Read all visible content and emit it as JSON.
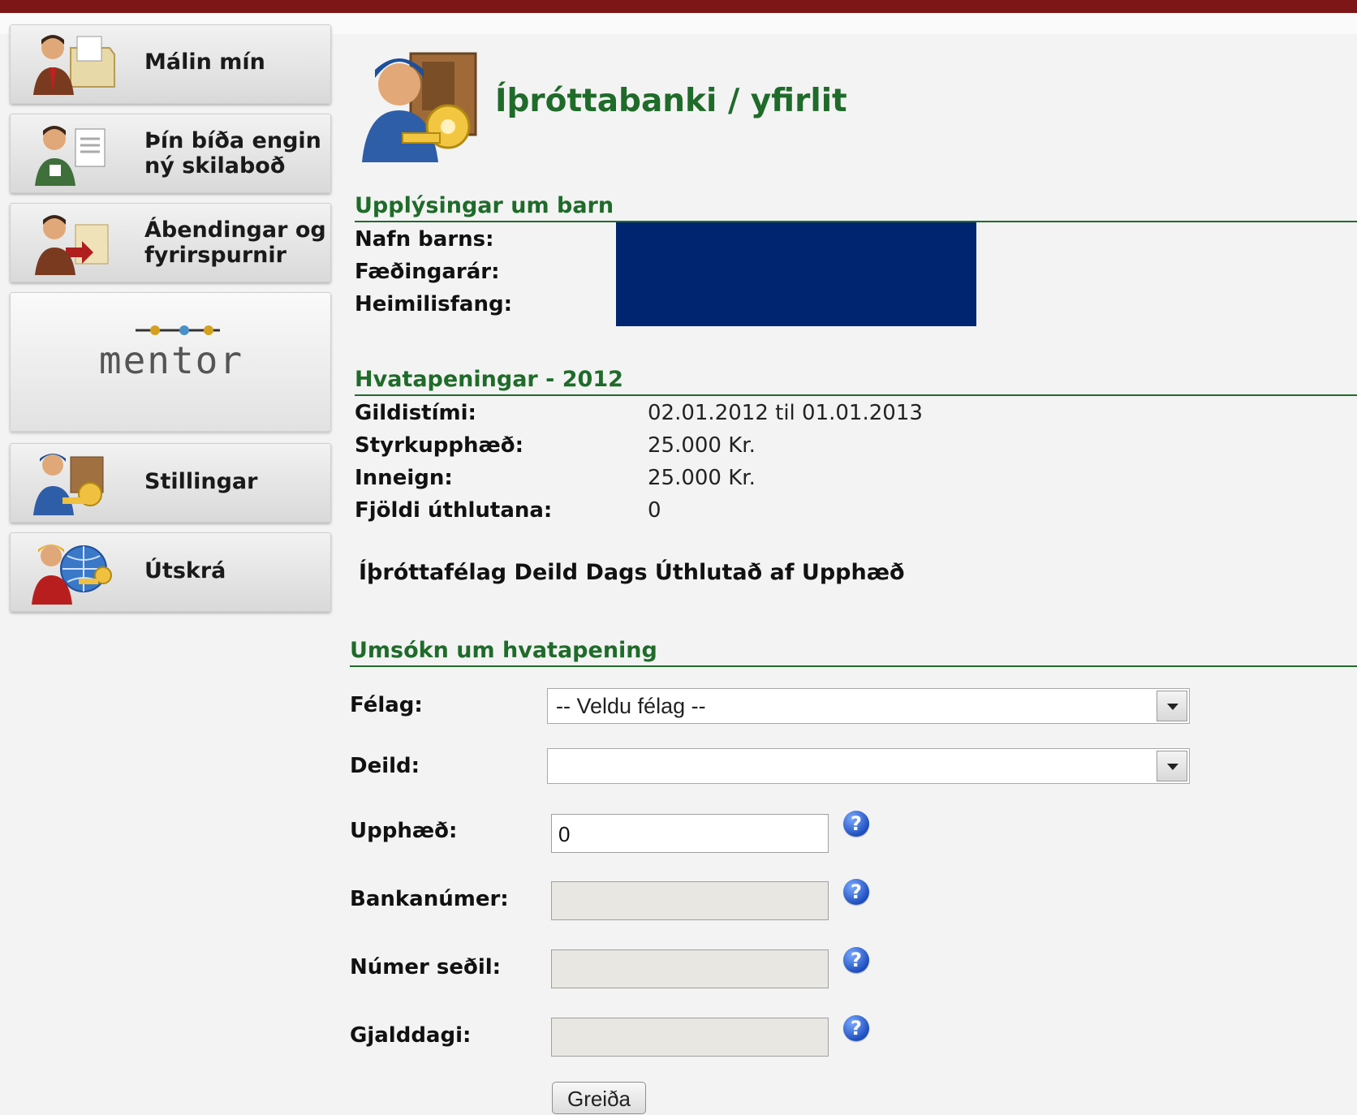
{
  "sidebar": {
    "items": [
      {
        "label": "Málin mín",
        "icon": "person-folder-icon"
      },
      {
        "label": "Þín bíða engin\nný skilaboð",
        "icon": "person-document-icon"
      },
      {
        "label": "Ábendingar og\nfyrirspurnir",
        "icon": "person-send-icon"
      },
      {
        "label": "Stillingar",
        "icon": "worker-key-icon"
      },
      {
        "label": "Útskrá",
        "icon": "person-globe-key-icon"
      }
    ],
    "logo_text": "mentor"
  },
  "page": {
    "title": "Íþróttabanki / yfirlit"
  },
  "child_info": {
    "heading": "Upplýsingar um barn",
    "labels": [
      "Nafn barns:",
      "Fæðingarár:",
      "Heimilisfang:"
    ]
  },
  "incentive": {
    "heading": "Hvatapeningar - 2012",
    "rows": [
      {
        "label": "Gildistími:",
        "value": "02.01.2012 til 01.01.2013"
      },
      {
        "label": "Styrkupphæð:",
        "value": "25.000 Kr."
      },
      {
        "label": "Inneign:",
        "value": "25.000 Kr."
      },
      {
        "label": "Fjöldi úthlutana:",
        "value": "0"
      }
    ],
    "table_header": "Íþróttafélag Deild Dags Úthlutað af Upphæð"
  },
  "application": {
    "heading": "Umsókn um hvatapening",
    "club_label": "Félag:",
    "club_selected": "-- Veldu félag --",
    "dept_label": "Deild:",
    "dept_selected": "",
    "amount_label": "Upphæð:",
    "amount_value": "0",
    "bank_label": "Bankanúmer:",
    "bank_value": "",
    "slip_label": "Númer seðil:",
    "slip_value": "",
    "due_label": "Gjalddagi:",
    "due_value": "",
    "help_glyph": "?",
    "submit_label": "Greiða"
  },
  "colors": {
    "top_bar": "#7d1717",
    "heading_green": "#1f6b2a",
    "redaction": "#002570",
    "help_blue": "#1f4fbf"
  }
}
